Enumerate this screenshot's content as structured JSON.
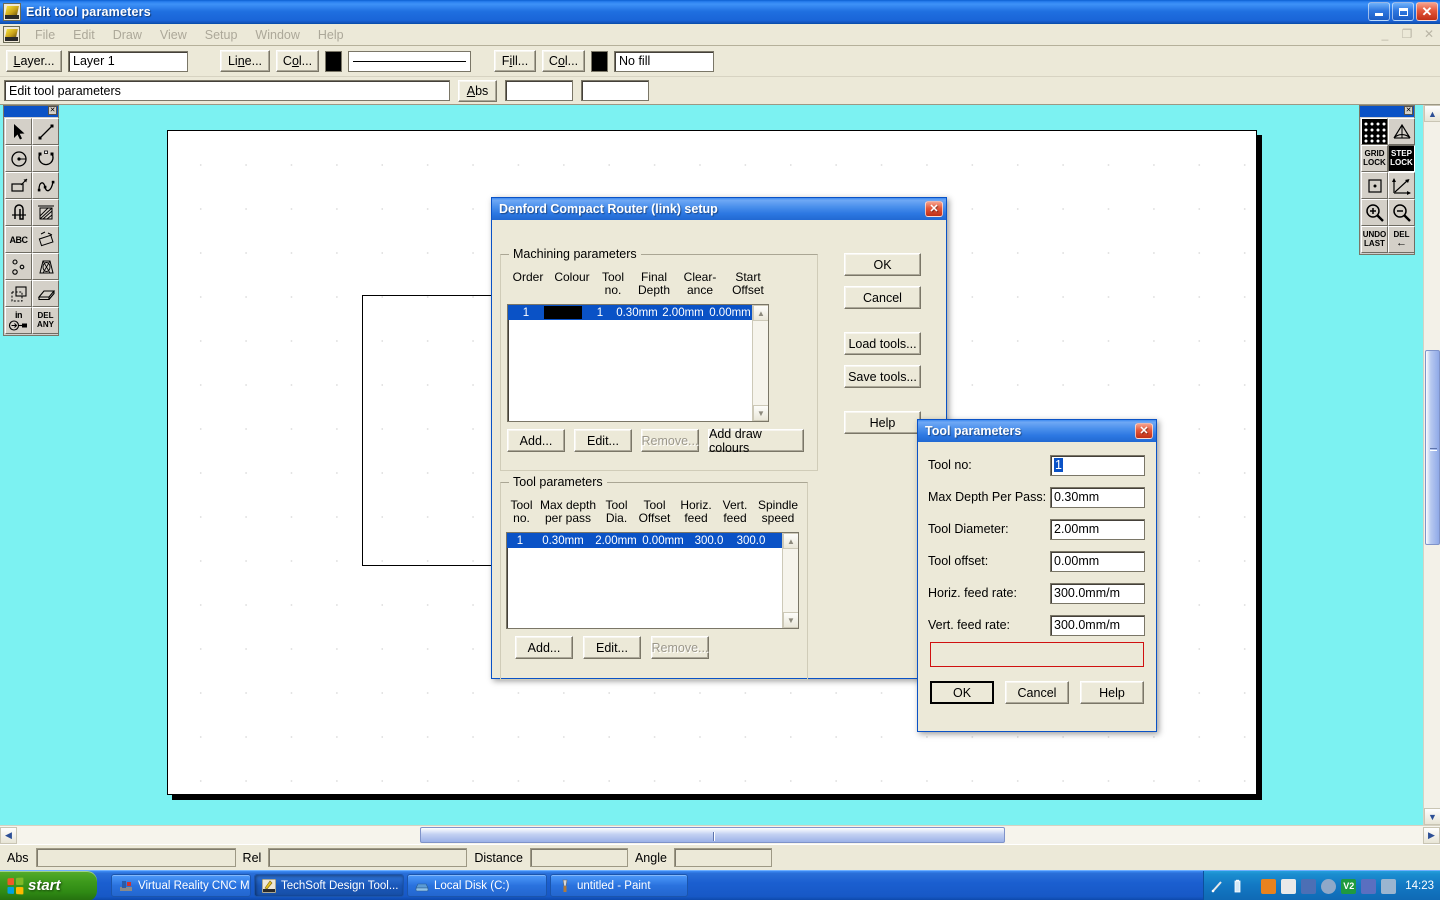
{
  "app": {
    "title": "Edit tool parameters",
    "icon": "cad-app-icon",
    "window_buttons": {
      "minimize": "minimize-icon",
      "maximize": "maximize-icon",
      "close": "close-icon"
    },
    "menu": [
      "File",
      "Edit",
      "Draw",
      "View",
      "Setup",
      "Window",
      "Help"
    ],
    "mdi_buttons": [
      "minimize-icon",
      "restore-icon",
      "close-icon"
    ]
  },
  "propbar": {
    "layer_button": "Layer...",
    "layer_value": "Layer 1",
    "line_button": "Line...",
    "line_colour_button": "Col...",
    "line_swatch": "#000000",
    "fill_button": "Fill...",
    "fill_colour_button": "Col...",
    "fill_swatch": "#000000",
    "fill_value": "No fill"
  },
  "cmdbar": {
    "command_value": "Edit tool parameters",
    "abs_button": "Abs",
    "field_x": "",
    "field_y": ""
  },
  "left_palette": {
    "tools": [
      {
        "name": "select-arrow-icon"
      },
      {
        "name": "line-icon"
      },
      {
        "name": "circle-icon"
      },
      {
        "name": "arc-icon"
      },
      {
        "name": "rectangle-icon"
      },
      {
        "name": "curve-icon"
      },
      {
        "name": "shape-icon"
      },
      {
        "name": "hatch-icon"
      },
      {
        "name": "text-icon",
        "label": "ABC"
      },
      {
        "name": "dimension-icon"
      },
      {
        "name": "array-icon"
      },
      {
        "name": "transform-icon"
      },
      {
        "name": "copy-icon"
      },
      {
        "name": "extrude-icon"
      },
      {
        "name": "input-units-icon",
        "label": "in"
      },
      {
        "name": "delete-any-icon",
        "label1": "DEL",
        "label2": "ANY"
      }
    ]
  },
  "right_palette": {
    "tools": [
      {
        "name": "grid-dots-icon"
      },
      {
        "name": "snap-angle-icon"
      },
      {
        "name": "grid-lock-button",
        "label1": "GRID",
        "label2": "LOCK"
      },
      {
        "name": "step-lock-button",
        "label1": "STEP",
        "label2": "LOCK",
        "active": true
      },
      {
        "name": "origin-point-icon"
      },
      {
        "name": "axes-icon"
      },
      {
        "name": "zoom-in-icon"
      },
      {
        "name": "zoom-out-icon"
      },
      {
        "name": "undo-last-button",
        "label1": "UNDO",
        "label2": "LAST"
      },
      {
        "name": "delete-back-button",
        "label1": "DEL",
        "label2": "arrow-left"
      }
    ]
  },
  "statusbar": {
    "abs_label": "Abs",
    "abs_value": "",
    "rel_label": "Rel",
    "rel_value": "",
    "distance_label": "Distance",
    "distance_value": "",
    "angle_label": "Angle",
    "angle_value": ""
  },
  "setup_dialog": {
    "title": "Denford Compact Router (link) setup",
    "close": "close-icon",
    "machining": {
      "legend": "Machining parameters",
      "columns": [
        {
          "l1": "Order",
          "l2": ""
        },
        {
          "l1": "Colour",
          "l2": ""
        },
        {
          "l1": "Tool",
          "l2": "no."
        },
        {
          "l1": "Final",
          "l2": "Depth"
        },
        {
          "l1": "Clear-",
          "l2": "ance"
        },
        {
          "l1": "Start",
          "l2": "Offset"
        }
      ],
      "rows": [
        {
          "order": "1",
          "colour": "#000000",
          "tool_no": "1",
          "final_depth": "0.30mm",
          "clearance": "2.00mm",
          "start_offset": "0.00mm",
          "selected": true
        }
      ],
      "buttons": [
        "Add...",
        "Edit...",
        "Remove...",
        "Add draw colours"
      ],
      "remove_disabled": true
    },
    "tools": {
      "legend": "Tool parameters",
      "columns": [
        {
          "l1": "Tool",
          "l2": "no."
        },
        {
          "l1": "Max depth",
          "l2": "per pass"
        },
        {
          "l1": "Tool",
          "l2": "Dia."
        },
        {
          "l1": "Tool",
          "l2": "Offset"
        },
        {
          "l1": "Horiz.",
          "l2": "feed"
        },
        {
          "l1": "Vert.",
          "l2": "feed"
        },
        {
          "l1": "Spindle",
          "l2": "speed"
        }
      ],
      "rows": [
        {
          "tool_no": "1",
          "max_depth": "0.30mm",
          "dia": "2.00mm",
          "offset": "0.00mm",
          "horiz": "300.0",
          "vert": "300.0",
          "spindle": "",
          "selected": true
        }
      ],
      "buttons": [
        "Add...",
        "Edit...",
        "Remove..."
      ],
      "remove_disabled": true
    },
    "side_buttons": [
      "OK",
      "Cancel",
      "Load tools...",
      "Save tools...",
      "Help"
    ]
  },
  "tool_dialog": {
    "title": "Tool parameters",
    "close": "close-icon",
    "fields": [
      {
        "label": "Tool no:",
        "value": "1",
        "selected": true
      },
      {
        "label": "Max Depth Per Pass:",
        "value": "0.30mm"
      },
      {
        "label": "Tool Diameter:",
        "value": "2.00mm"
      },
      {
        "label": "Tool offset:",
        "value": "0.00mm"
      },
      {
        "label": "Horiz. feed rate:",
        "value": "300.0mm/m"
      },
      {
        "label": "Vert. feed rate:",
        "value": "300.0mm/m"
      }
    ],
    "message": "",
    "buttons": [
      "OK",
      "Cancel",
      "Help"
    ]
  },
  "taskbar": {
    "start": "start",
    "items": [
      {
        "label": "Virtual Reality CNC Mi...",
        "icon": "cnc-icon",
        "active": false
      },
      {
        "label": "TechSoft Design Tool...",
        "icon": "cad-app-icon",
        "active": true
      },
      {
        "label": "Local Disk (C:)",
        "icon": "drive-icon",
        "active": false
      },
      {
        "label": "untitled - Paint",
        "icon": "paint-icon",
        "active": false
      }
    ],
    "clock": "14:23",
    "tray_icons": [
      "pen-icon",
      "battery-icon",
      "acrobat-icon",
      "sync-icon",
      "network-icon",
      "disc-icon",
      "v2-icon",
      "messenger-icon",
      "display-icon"
    ]
  },
  "colors": {
    "desktop": "#7cf2f2",
    "dialog_face": "#ece9d8",
    "title_blue": "#0a52c6",
    "selection_blue": "#0a52c6",
    "error_red": "#d01010"
  }
}
